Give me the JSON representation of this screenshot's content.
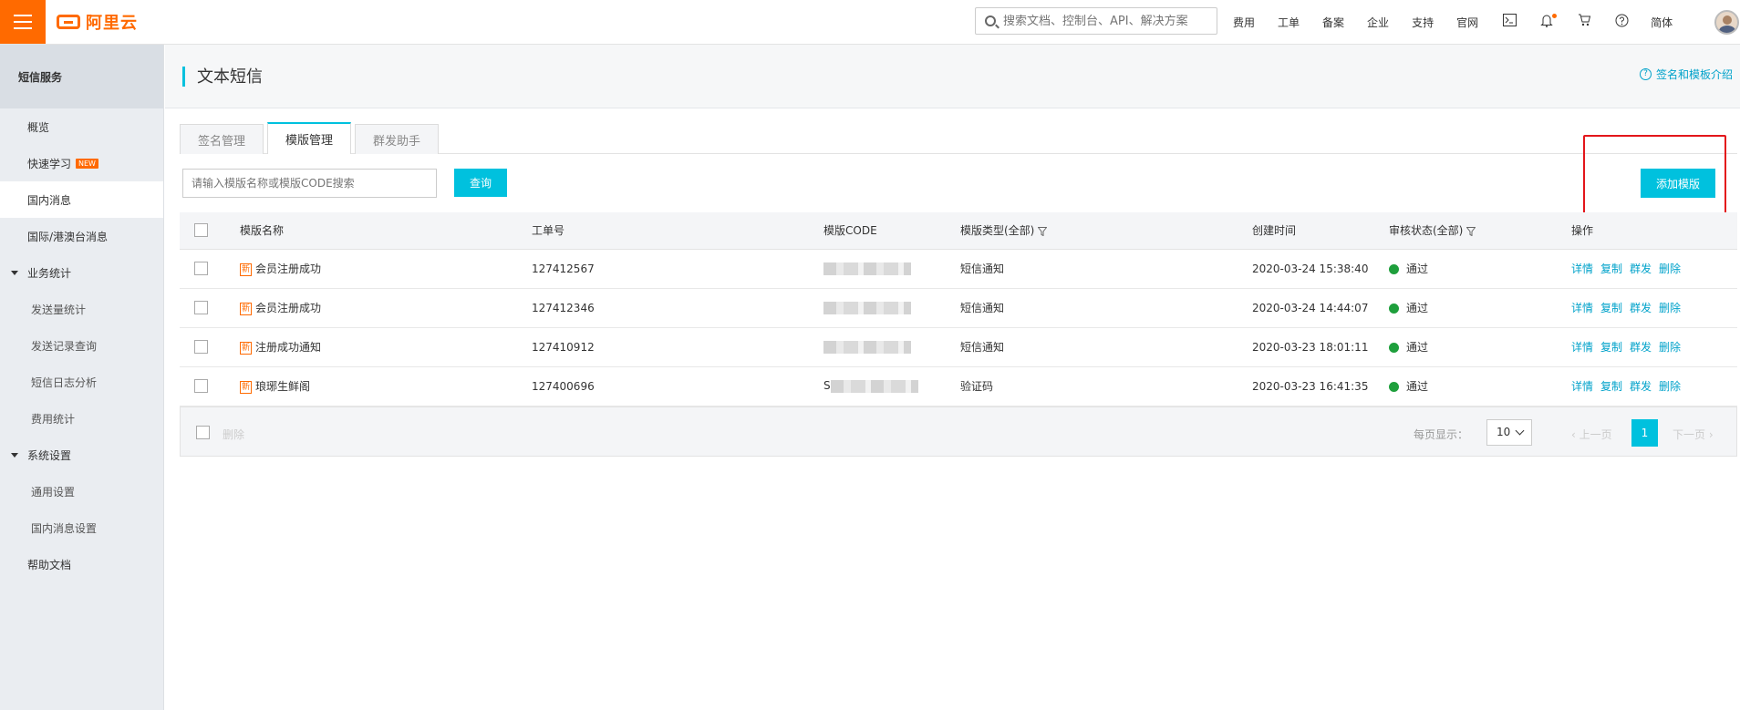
{
  "topbar": {
    "logo_text": "阿里云",
    "search_placeholder": "搜索文档、控制台、API、解决方案",
    "links": [
      "费用",
      "工单",
      "备案",
      "企业",
      "支持",
      "官网"
    ],
    "lang": "简体",
    "icons": [
      "terminal-icon",
      "bell-icon",
      "cart-icon",
      "help-icon"
    ]
  },
  "sidebar": {
    "title": "短信服务",
    "items": [
      {
        "label": "概览"
      },
      {
        "label": "快速学习",
        "badge": "NEW"
      },
      {
        "label": "国内消息"
      },
      {
        "label": "国际/港澳台消息"
      },
      {
        "label": "业务统计"
      },
      {
        "label": "发送量统计"
      },
      {
        "label": "发送记录查询"
      },
      {
        "label": "短信日志分析"
      },
      {
        "label": "费用统计"
      },
      {
        "label": "系统设置"
      },
      {
        "label": "通用设置"
      },
      {
        "label": "国内消息设置"
      },
      {
        "label": "帮助文档"
      }
    ]
  },
  "page": {
    "title": "文本短信",
    "help_link": "签名和模板介绍",
    "tabs": [
      "签名管理",
      "模版管理",
      "群发助手"
    ],
    "search_placeholder": "请输入模版名称或模版CODE搜索",
    "query_btn": "查询",
    "add_btn": "添加模版"
  },
  "table": {
    "columns": [
      "模版名称",
      "工单号",
      "模版CODE",
      "模版类型(全部)",
      "创建时间",
      "审核状态(全部)",
      "操作"
    ],
    "new_tag": "新",
    "rows": [
      {
        "name": "会员注册成功",
        "ticket": "127412567",
        "code_prefix": "",
        "type": "短信通知",
        "created": "2020-03-24 15:38:40",
        "status": "通过"
      },
      {
        "name": "会员注册成功",
        "ticket": "127412346",
        "code_prefix": "",
        "type": "短信通知",
        "created": "2020-03-24 14:44:07",
        "status": "通过"
      },
      {
        "name": "注册成功通知",
        "ticket": "127410912",
        "code_prefix": "",
        "type": "短信通知",
        "created": "2020-03-23 18:01:11",
        "status": "通过"
      },
      {
        "name": "琅琊生鲜阁",
        "ticket": "127400696",
        "code_prefix": "S",
        "type": "验证码",
        "created": "2020-03-23 16:41:35",
        "status": "通过"
      }
    ],
    "actions": [
      "详情",
      "复制",
      "群发",
      "删除"
    ]
  },
  "footer": {
    "delete_label": "删除",
    "per_page_label": "每页显示：",
    "per_page_value": "10",
    "prev": "上一页",
    "next": "下一页",
    "current_page": "1"
  },
  "colors": {
    "brand": "#ff6a00",
    "accent": "#00c1de",
    "link": "#00a2ca",
    "success": "#1e9f3c",
    "highlight": "#e3161b"
  }
}
